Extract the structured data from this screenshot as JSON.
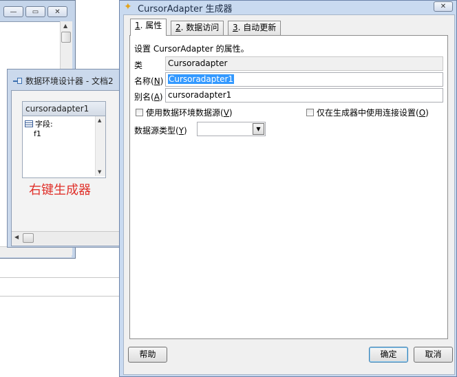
{
  "background_window": {
    "ctrl_icons": [
      "minimize-icon",
      "restore-icon",
      "close-icon"
    ],
    "ctrl_glyphs": [
      "—",
      "▭",
      "✕"
    ]
  },
  "data_env": {
    "title": "数据环境设计器 - 文档2",
    "cursor": {
      "title": "cursoradapter1",
      "fields_label": "字段:",
      "fields": [
        "f1"
      ]
    }
  },
  "annotation": {
    "text": "右键生成器",
    "color": "#e0302a"
  },
  "builder": {
    "title": "CursorAdapter 生成器",
    "close_glyph": "✕",
    "tabs": [
      {
        "num": "1",
        "label": ". 属性",
        "active": true
      },
      {
        "num": "2",
        "label": ". 数据访问",
        "active": false
      },
      {
        "num": "3",
        "label": ". 自动更新",
        "active": false
      }
    ],
    "description": "设置 CursorAdapter 的属性。",
    "class_label": "类",
    "class_value": "Cursoradapter",
    "name_label": "名称",
    "name_hotkey": "N",
    "name_value": "Cursoradapter1",
    "alias_label": "别名",
    "alias_hotkey": "A",
    "alias_value": "cursoradapter1",
    "use_de_label": "使用数据环境数据源",
    "use_de_hotkey": "V",
    "use_de_checked": false,
    "builder_conn_label": "仅在生成器中使用连接设置",
    "builder_conn_hotkey": "O",
    "builder_conn_checked": false,
    "ds_type_label": "数据源类型",
    "ds_type_hotkey": "Y",
    "ds_type_value": "",
    "help_button": "帮助",
    "ok_button": "确定",
    "cancel_button": "取消"
  },
  "colors": {
    "window_frame": "#c9daf0",
    "selection": "#3399ff"
  }
}
